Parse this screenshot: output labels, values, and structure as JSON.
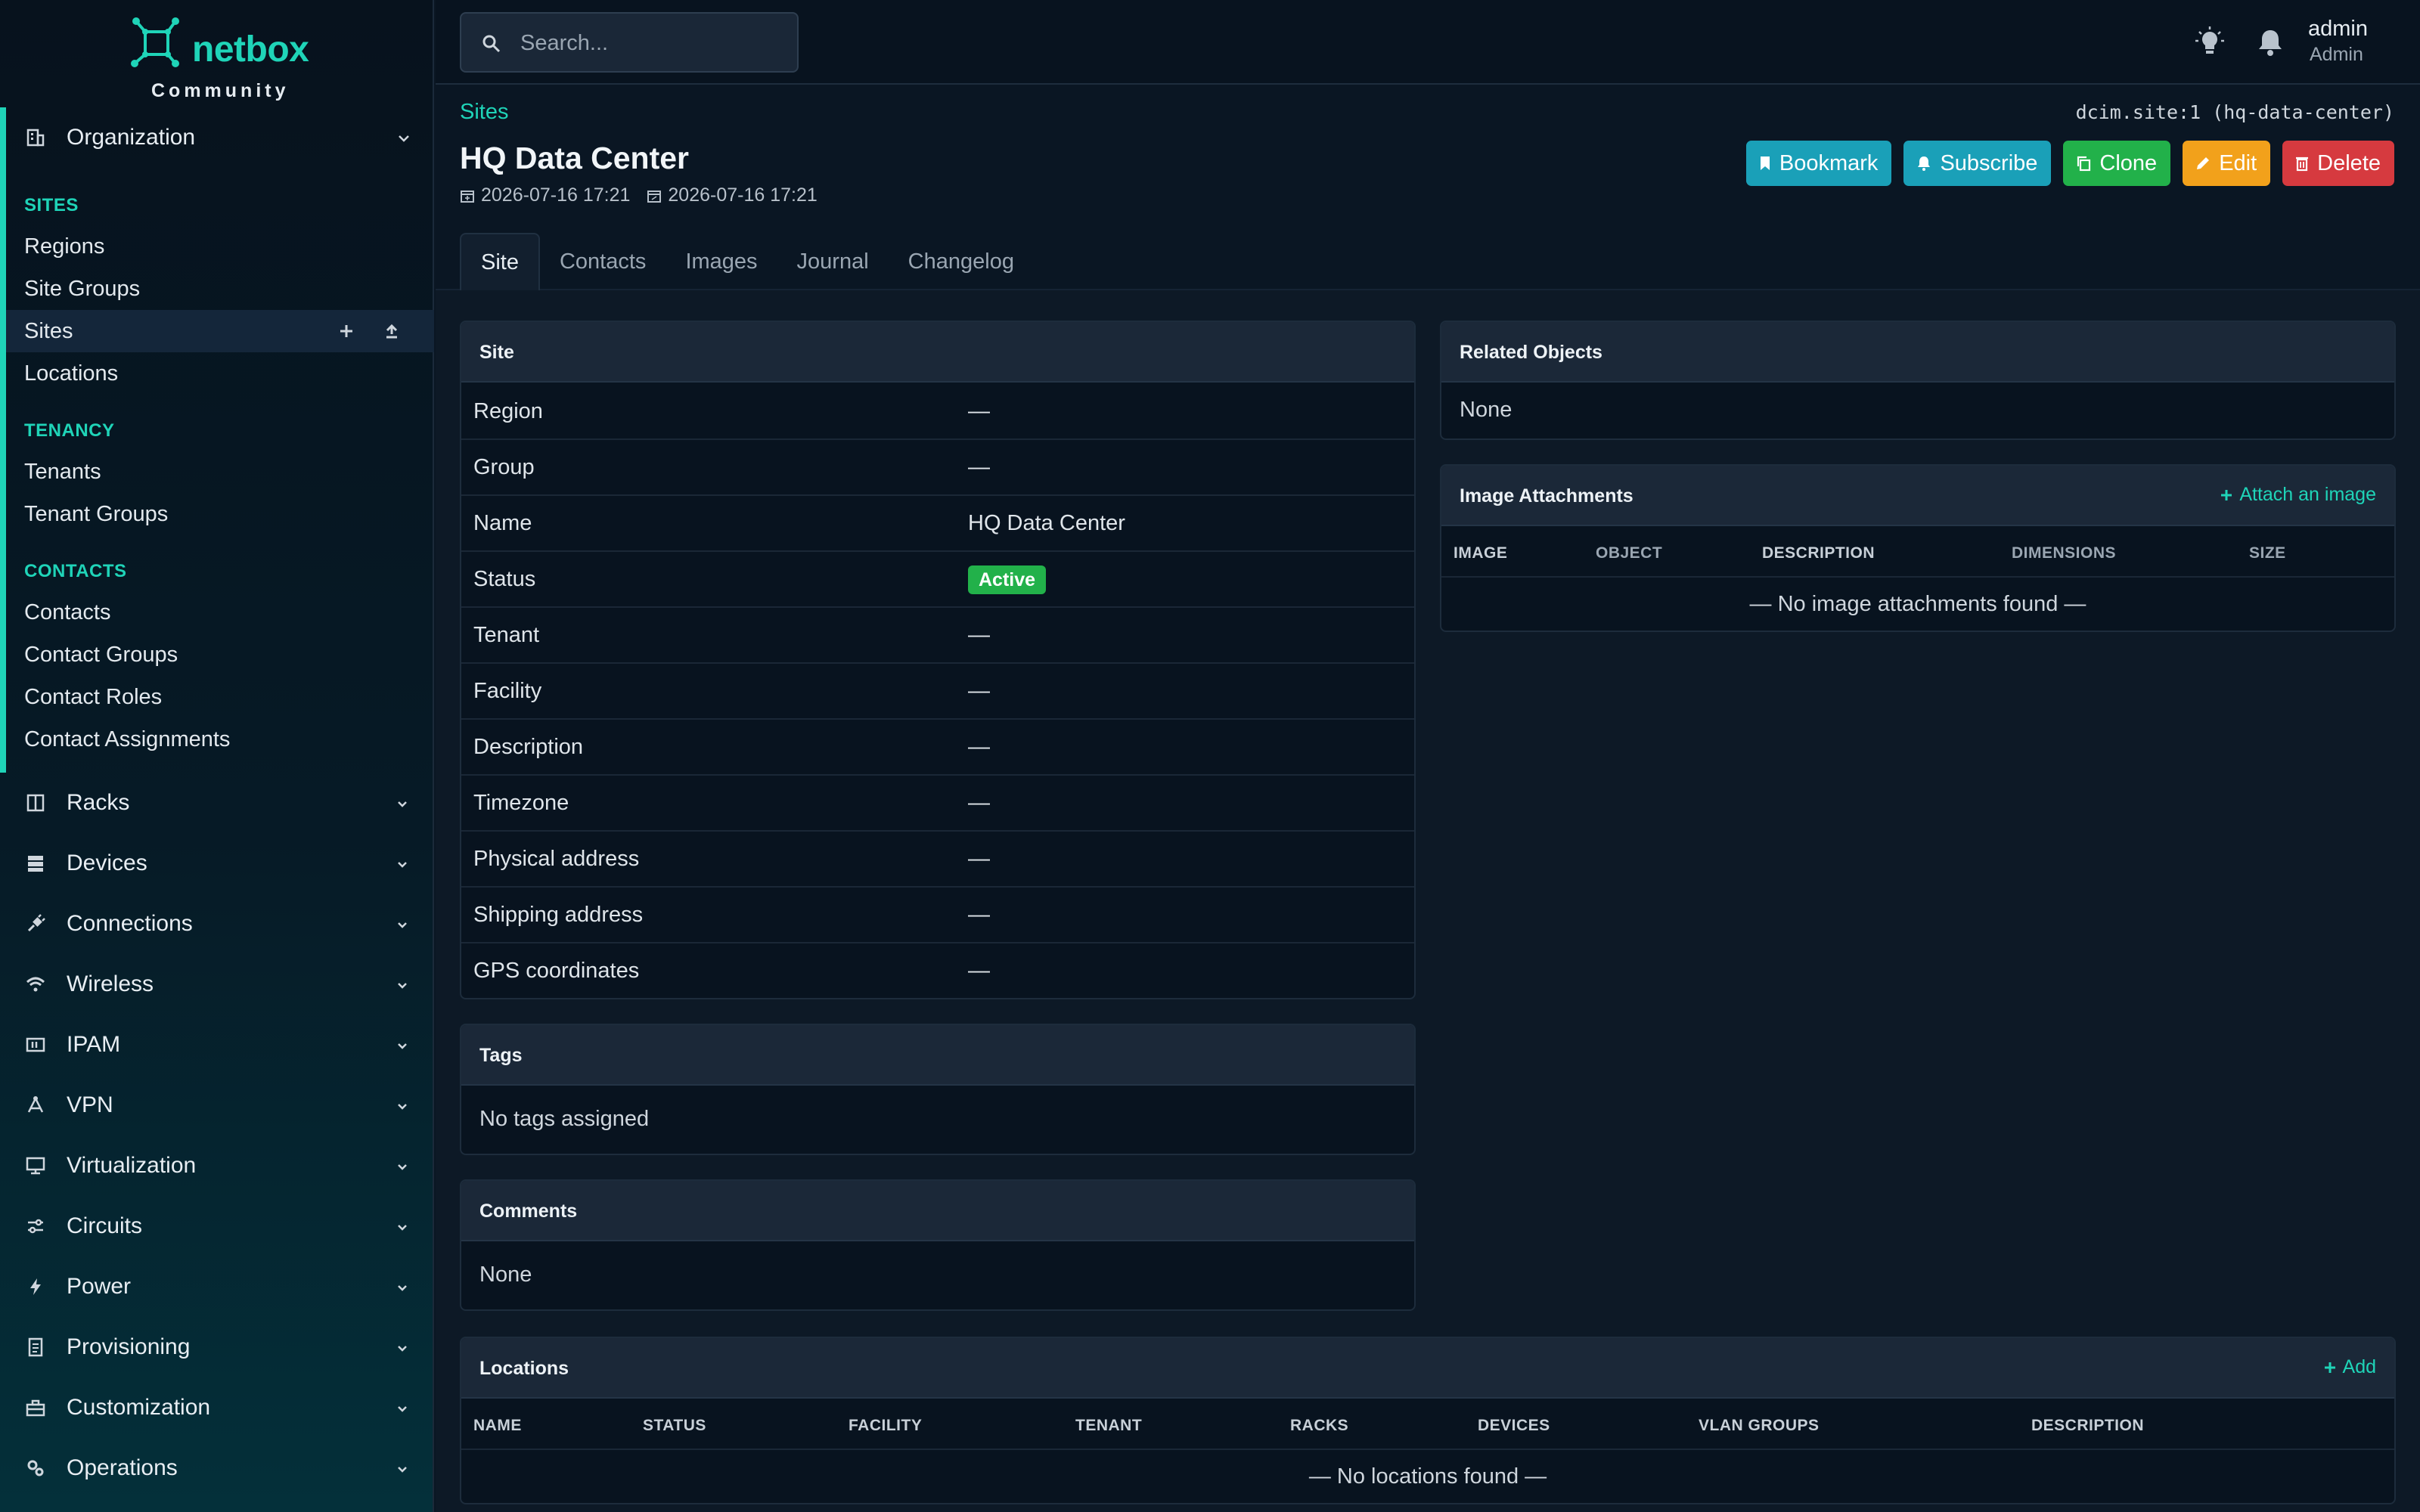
{
  "brand": {
    "name": "netbox",
    "edition": "Community"
  },
  "sidebar": {
    "organization": {
      "label": "Organization",
      "sections": [
        {
          "title": "SITES",
          "items": [
            "Regions",
            "Site Groups",
            "Sites",
            "Locations"
          ]
        },
        {
          "title": "TENANCY",
          "items": [
            "Tenants",
            "Tenant Groups"
          ]
        },
        {
          "title": "CONTACTS",
          "items": [
            "Contacts",
            "Contact Groups",
            "Contact Roles",
            "Contact Assignments"
          ]
        }
      ]
    },
    "menus": [
      "Racks",
      "Devices",
      "Connections",
      "Wireless",
      "IPAM",
      "VPN",
      "Virtualization",
      "Circuits",
      "Power",
      "Provisioning",
      "Customization",
      "Operations"
    ]
  },
  "topbar": {
    "search_placeholder": "Search...",
    "user": {
      "name": "admin",
      "role": "Admin"
    }
  },
  "header": {
    "breadcrumb": "Sites",
    "object_id": "dcim.site:1 (hq-data-center)",
    "title": "HQ Data Center",
    "created": "2026-07-16 17:21",
    "updated": "2026-07-16 17:21",
    "actions": {
      "bookmark": "Bookmark",
      "subscribe": "Subscribe",
      "clone": "Clone",
      "edit": "Edit",
      "delete": "Delete"
    }
  },
  "tabs": [
    "Site",
    "Contacts",
    "Images",
    "Journal",
    "Changelog"
  ],
  "site_card": {
    "title": "Site",
    "rows": [
      {
        "label": "Region",
        "value": "—"
      },
      {
        "label": "Group",
        "value": "—"
      },
      {
        "label": "Name",
        "value": "HQ Data Center"
      },
      {
        "label": "Status",
        "value": "Active"
      },
      {
        "label": "Tenant",
        "value": "—"
      },
      {
        "label": "Facility",
        "value": "—"
      },
      {
        "label": "Description",
        "value": "—"
      },
      {
        "label": "Timezone",
        "value": "—"
      },
      {
        "label": "Physical address",
        "value": "—"
      },
      {
        "label": "Shipping address",
        "value": "—"
      },
      {
        "label": "GPS coordinates",
        "value": "—"
      }
    ]
  },
  "tags_card": {
    "title": "Tags",
    "body": "No tags assigned"
  },
  "comments_card": {
    "title": "Comments",
    "body": "None"
  },
  "related_card": {
    "title": "Related Objects",
    "body": "None"
  },
  "images_card": {
    "title": "Image Attachments",
    "action": "Attach an image",
    "columns": [
      "IMAGE",
      "OBJECT",
      "DESCRIPTION",
      "DIMENSIONS",
      "SIZE"
    ],
    "empty": "— No image attachments found —"
  },
  "locations_card": {
    "title": "Locations",
    "action": "Add",
    "columns": [
      "NAME",
      "STATUS",
      "FACILITY",
      "TENANT",
      "RACKS",
      "DEVICES",
      "VLAN GROUPS",
      "DESCRIPTION"
    ],
    "empty": "— No locations found —"
  },
  "colors": {
    "accent": "#1fd4b8",
    "info": "#1aa0b8",
    "success": "#22b14a",
    "warning": "#f2a11b",
    "danger": "#d63a3f"
  }
}
